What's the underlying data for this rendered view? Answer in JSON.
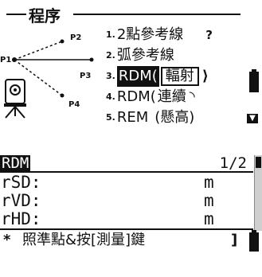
{
  "menu": {
    "title": "程序",
    "items": [
      {
        "num": "1.",
        "text": "2點參考線",
        "suffix": "",
        "tail": "?"
      },
      {
        "num": "2.",
        "text": "弧參考線",
        "suffix": "",
        "tail": ""
      },
      {
        "num": "3.",
        "text": "RDM(",
        "suffix": "輻射",
        "tail": "⟩"
      },
      {
        "num": "4.",
        "text": "RDM(",
        "suffix": "連續",
        "tail": "◝"
      },
      {
        "num": "5.",
        "text": "REM",
        "suffix": "(懸高)",
        "tail": ""
      }
    ],
    "diagram_points": [
      "P1",
      "P2",
      "P3",
      "P4"
    ]
  },
  "rdm": {
    "title": "RDM",
    "page": "1/2",
    "rows": [
      {
        "label": "rSD:",
        "value": "",
        "unit": "m"
      },
      {
        "label": "rVD:",
        "value": "",
        "unit": "m"
      },
      {
        "label": "rHD:",
        "value": "",
        "unit": "m"
      }
    ],
    "footer_star": "*",
    "footer_text": "照準點&按[測量]鍵",
    "footer_bracket": "]"
  }
}
